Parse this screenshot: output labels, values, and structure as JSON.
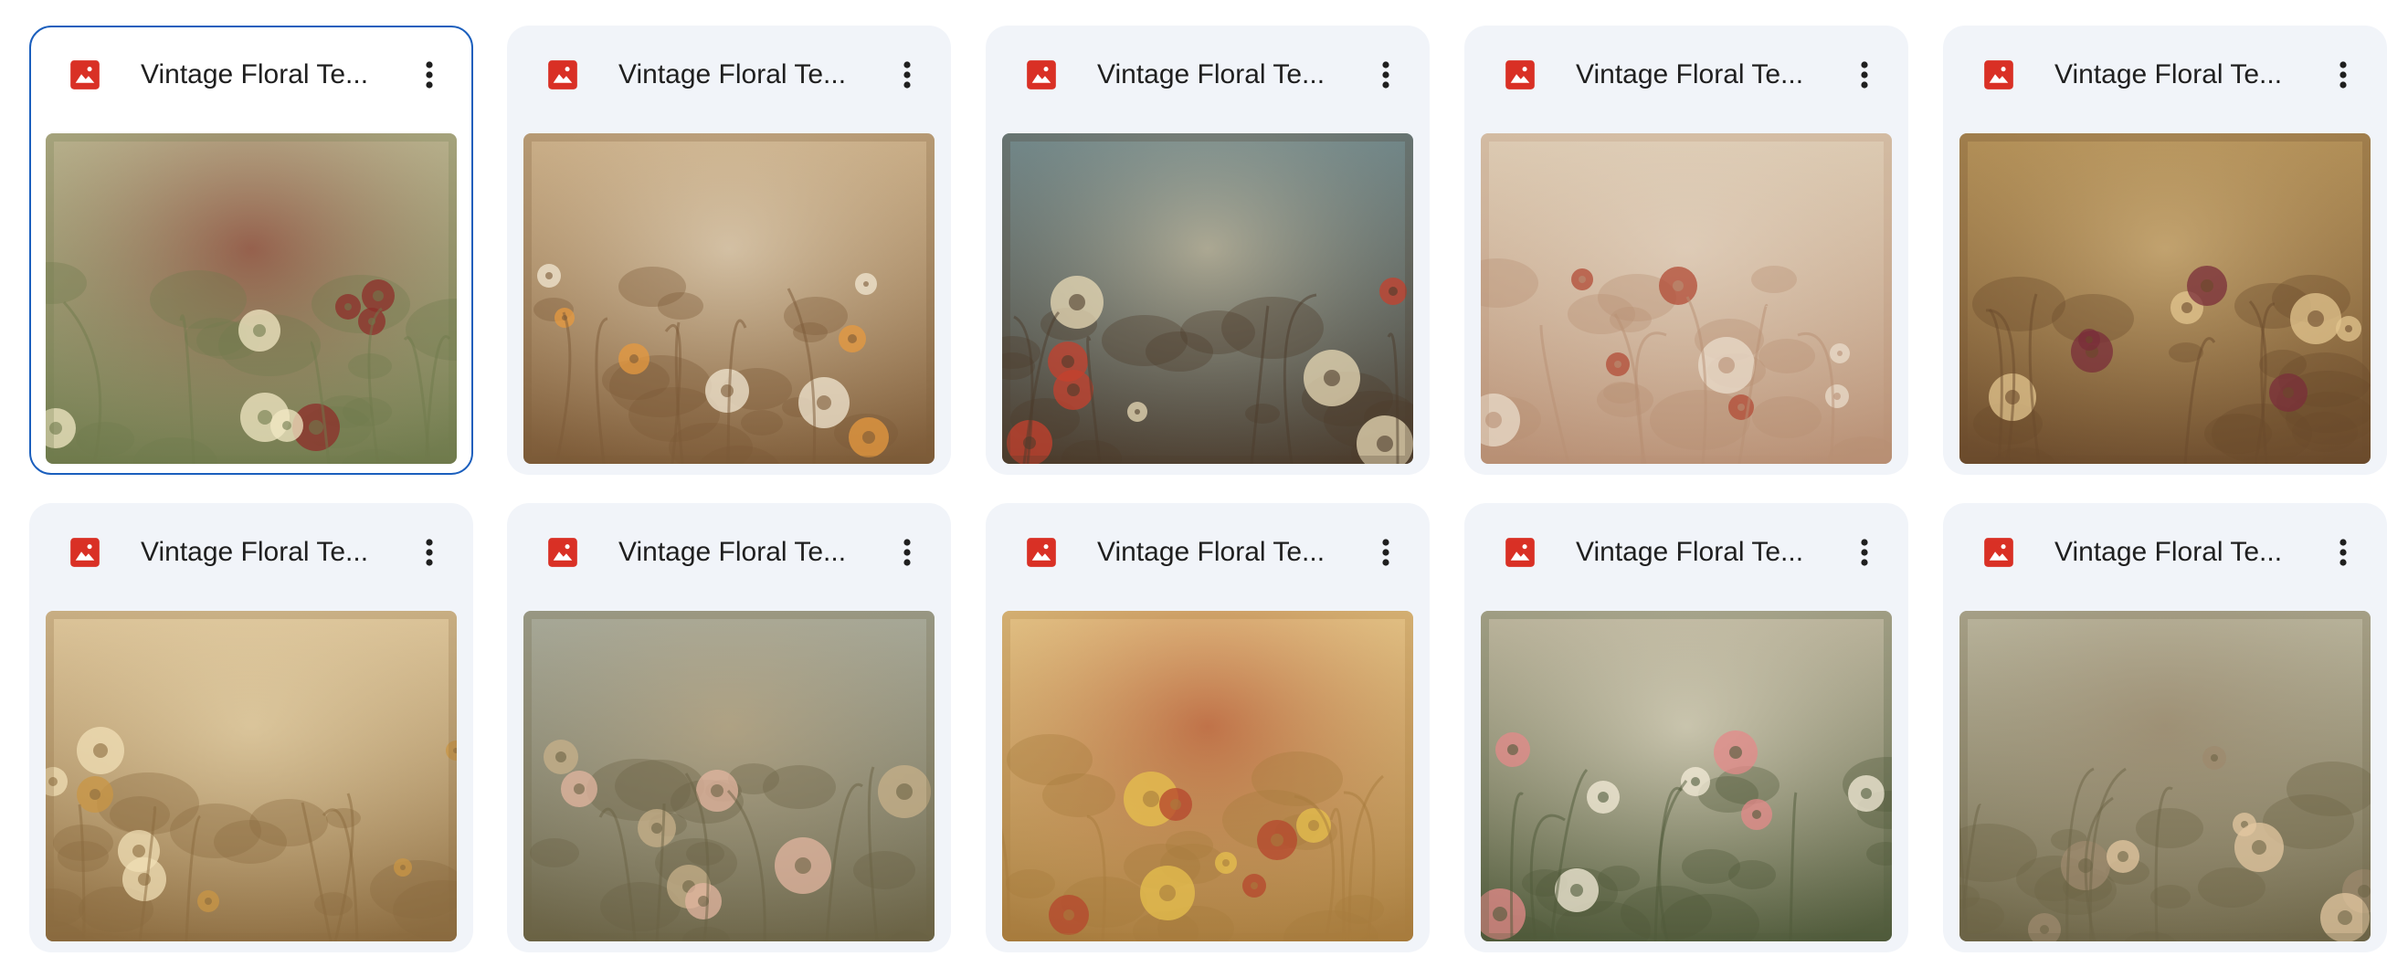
{
  "files": [
    {
      "name": "Vintage Floral Te...",
      "selected": true,
      "thumbnail": "vintage-floral-texture-1",
      "palette": [
        "#b8b38e",
        "#6f7a4c",
        "#f2e8c4",
        "#8e2d2a"
      ]
    },
    {
      "name": "Vintage Floral Te...",
      "selected": false,
      "thumbnail": "vintage-floral-texture-2",
      "palette": [
        "#c9ad86",
        "#7c5a37",
        "#e79a3f",
        "#f1e7d2"
      ]
    },
    {
      "name": "Vintage Floral Te...",
      "selected": false,
      "thumbnail": "vintage-floral-texture-3",
      "palette": [
        "#6e8588",
        "#4c3c2c",
        "#c6402e",
        "#e8d9b5"
      ]
    },
    {
      "name": "Vintage Floral Te...",
      "selected": false,
      "thumbnail": "vintage-floral-texture-4",
      "palette": [
        "#dccab2",
        "#b88f74",
        "#b24b36",
        "#e9dccb"
      ]
    },
    {
      "name": "Vintage Floral Te...",
      "selected": false,
      "thumbnail": "vintage-floral-texture-5",
      "palette": [
        "#b18e56",
        "#6a4a2c",
        "#7a2d3a",
        "#e3c68f"
      ]
    },
    {
      "name": "Vintage Floral Te...",
      "selected": false,
      "thumbnail": "vintage-floral-texture-6",
      "palette": [
        "#dbc398",
        "#8a6a3e",
        "#c99644",
        "#f0dfb6"
      ]
    },
    {
      "name": "Vintage Floral Te...",
      "selected": false,
      "thumbnail": "vintage-floral-texture-7",
      "palette": [
        "#a6a898",
        "#6a6244",
        "#e3b6a0",
        "#c7b08a"
      ]
    },
    {
      "name": "Vintage Floral Te...",
      "selected": false,
      "thumbnail": "vintage-floral-texture-8",
      "palette": [
        "#e2c285",
        "#a77b3d",
        "#e7c04e",
        "#b5452c"
      ]
    },
    {
      "name": "Vintage Floral Te...",
      "selected": false,
      "thumbnail": "vintage-floral-texture-9",
      "palette": [
        "#b9b29a",
        "#4f5a3a",
        "#e48a8a",
        "#f4ecd8"
      ]
    },
    {
      "name": "Vintage Floral Te...",
      "selected": false,
      "thumbnail": "vintage-floral-texture-10",
      "palette": [
        "#b9b49c",
        "#6c6446",
        "#e3c7a0",
        "#9e8a6e"
      ]
    }
  ],
  "icons": {
    "file_type": "image-file-icon",
    "menu": "more-vert-icon"
  },
  "colors": {
    "card_bg": "#f1f4f9",
    "selection_border": "#1b5fbd",
    "image_icon": "#d93025",
    "title": "#1f1f1f"
  }
}
